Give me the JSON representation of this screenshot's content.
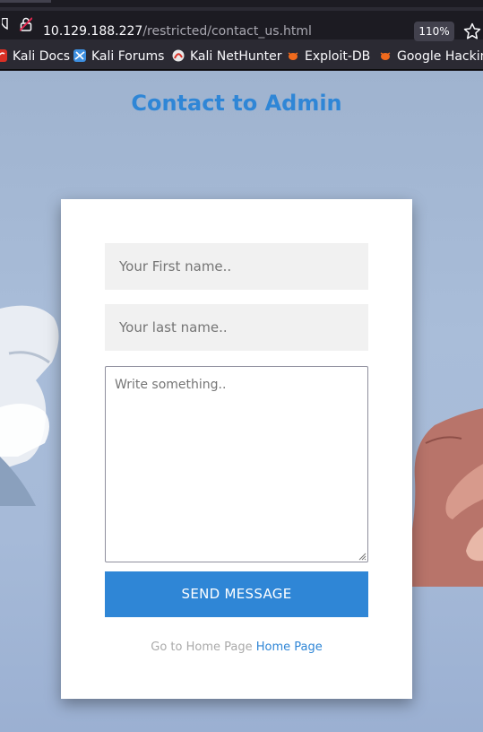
{
  "browser": {
    "url_host": "10.129.188.227",
    "url_path": "/restricted/contact_us.html",
    "zoom": "110%"
  },
  "bookmarks": [
    {
      "label": "Kali Docs",
      "icon": "kali-dragon-icon"
    },
    {
      "label": "Kali Forums",
      "icon": "kali-forums-icon"
    },
    {
      "label": "Kali NetHunter",
      "icon": "nethunter-icon"
    },
    {
      "label": "Exploit-DB",
      "icon": "exploitdb-bug-icon"
    },
    {
      "label": "Google Hacking",
      "icon": "ghdb-bug-icon"
    }
  ],
  "page": {
    "title": "Contact to Admin",
    "form": {
      "first_name_placeholder": "Your First name..",
      "last_name_placeholder": "Your last name..",
      "message_placeholder": "Write something..",
      "send_label": "SEND MESSAGE"
    },
    "footer": {
      "prefix": "Go to Home Page",
      "link_label": "Home Page"
    }
  },
  "colors": {
    "accent": "#2f86d6",
    "browser_bg": "#2b2a33"
  }
}
